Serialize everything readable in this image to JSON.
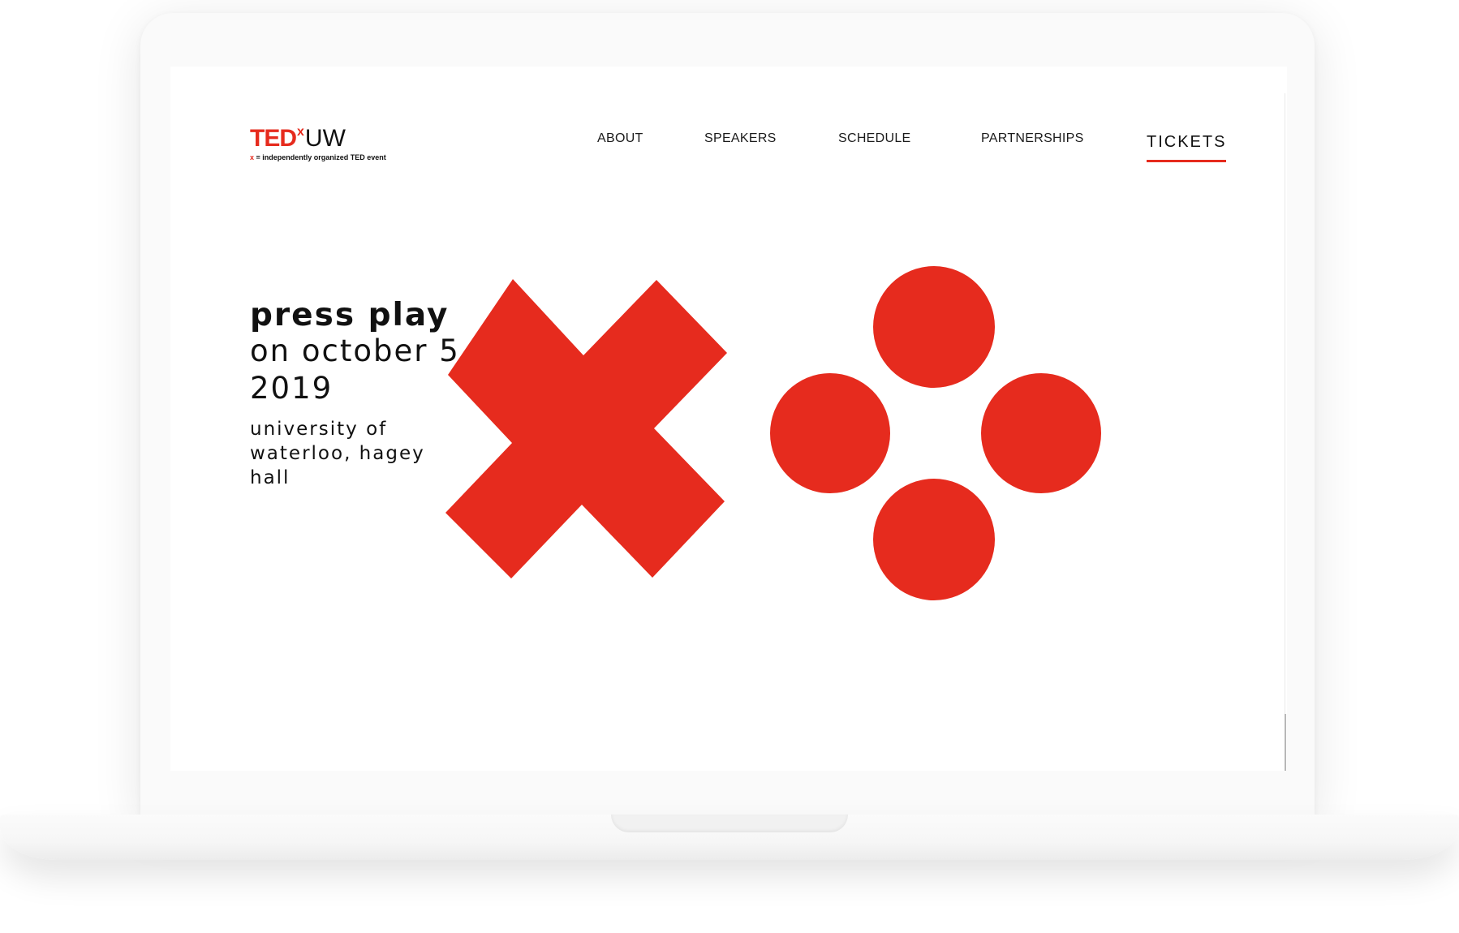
{
  "header": {
    "logo": {
      "ted": "TED",
      "x": "x",
      "uw": "UW",
      "tagline_x": "x",
      "tagline_rest": " = independently organized TED event"
    },
    "nav": [
      {
        "label": "ABOUT"
      },
      {
        "label": "SPEAKERS"
      },
      {
        "label": "SCHEDULE"
      },
      {
        "label": "PARTNERSHIPS"
      },
      {
        "label": "TICKETS"
      }
    ]
  },
  "hero": {
    "title": "press play",
    "date": "on october 5, 2019",
    "location": "university of waterloo, hagey hall"
  },
  "graphic": {
    "icons": [
      "x-button-icon",
      "four-dots-button-icon"
    ],
    "accent_color": "#e62b1e"
  },
  "colors": {
    "accent": "#e62b1e",
    "text": "#111111",
    "background": "#ffffff"
  }
}
